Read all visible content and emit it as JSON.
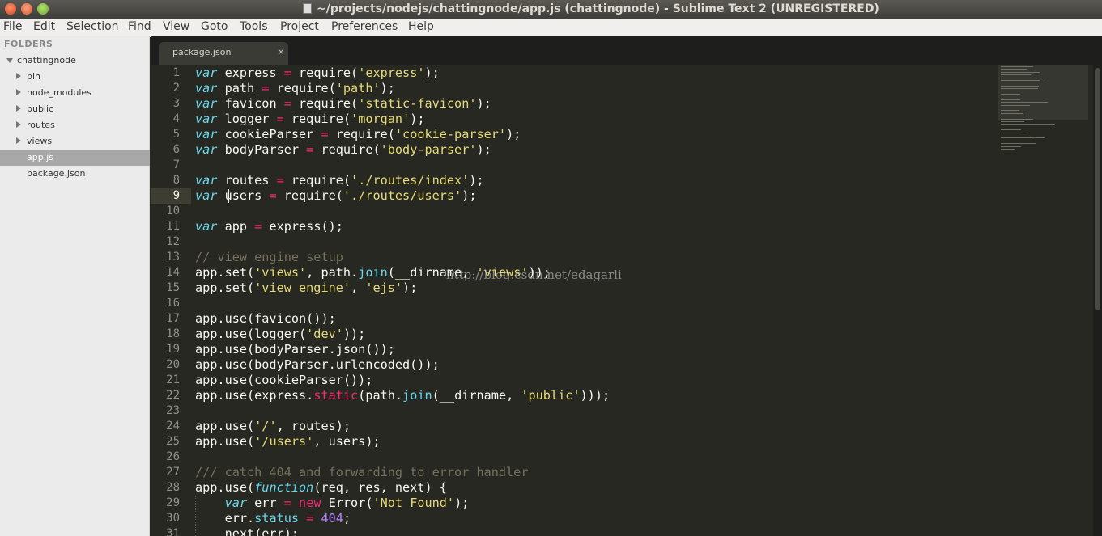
{
  "window": {
    "title": "~/projects/nodejs/chattingnode/app.js (chattingnode) - Sublime Text 2 (UNREGISTERED)",
    "close_icon": "close-icon",
    "minimize_icon": "minimize-icon",
    "maximize_icon": "maximize-icon"
  },
  "menu": [
    "File",
    "Edit",
    "Selection",
    "Find",
    "View",
    "Goto",
    "Tools",
    "Project",
    "Preferences",
    "Help"
  ],
  "sidebar": {
    "header": "FOLDERS",
    "root": "chattingnode",
    "items": [
      {
        "label": "bin",
        "type": "folder"
      },
      {
        "label": "node_modules",
        "type": "folder"
      },
      {
        "label": "public",
        "type": "folder"
      },
      {
        "label": "routes",
        "type": "folder"
      },
      {
        "label": "views",
        "type": "folder"
      },
      {
        "label": "app.js",
        "type": "file",
        "selected": true
      },
      {
        "label": "package.json",
        "type": "file"
      }
    ]
  },
  "tabs": [
    {
      "label": "package.json",
      "close": "×"
    }
  ],
  "editor": {
    "active_line": 9,
    "lines": [
      [
        [
          "kw",
          "var"
        ],
        [
          "t",
          " express "
        ],
        [
          "op",
          "="
        ],
        [
          "t",
          " require("
        ],
        [
          "str",
          "'express'"
        ],
        [
          "t",
          ");"
        ]
      ],
      [
        [
          "kw",
          "var"
        ],
        [
          "t",
          " path "
        ],
        [
          "op",
          "="
        ],
        [
          "t",
          " require("
        ],
        [
          "str",
          "'path'"
        ],
        [
          "t",
          ");"
        ]
      ],
      [
        [
          "kw",
          "var"
        ],
        [
          "t",
          " favicon "
        ],
        [
          "op",
          "="
        ],
        [
          "t",
          " require("
        ],
        [
          "str",
          "'static-favicon'"
        ],
        [
          "t",
          ");"
        ]
      ],
      [
        [
          "kw",
          "var"
        ],
        [
          "t",
          " logger "
        ],
        [
          "op",
          "="
        ],
        [
          "t",
          " require("
        ],
        [
          "str",
          "'morgan'"
        ],
        [
          "t",
          ");"
        ]
      ],
      [
        [
          "kw",
          "var"
        ],
        [
          "t",
          " cookieParser "
        ],
        [
          "op",
          "="
        ],
        [
          "t",
          " require("
        ],
        [
          "str",
          "'cookie-parser'"
        ],
        [
          "t",
          ");"
        ]
      ],
      [
        [
          "kw",
          "var"
        ],
        [
          "t",
          " bodyParser "
        ],
        [
          "op",
          "="
        ],
        [
          "t",
          " require("
        ],
        [
          "str",
          "'body-parser'"
        ],
        [
          "t",
          ");"
        ]
      ],
      [],
      [
        [
          "kw",
          "var"
        ],
        [
          "t",
          " routes "
        ],
        [
          "op",
          "="
        ],
        [
          "t",
          " require("
        ],
        [
          "str",
          "'./routes/index'"
        ],
        [
          "t",
          ");"
        ]
      ],
      [
        [
          "kw",
          "var"
        ],
        [
          "t",
          " users "
        ],
        [
          "op",
          "="
        ],
        [
          "t",
          " require("
        ],
        [
          "str",
          "'./routes/users'"
        ],
        [
          "t",
          ");"
        ]
      ],
      [],
      [
        [
          "kw",
          "var"
        ],
        [
          "t",
          " app "
        ],
        [
          "op",
          "="
        ],
        [
          "t",
          " express();"
        ]
      ],
      [],
      [
        [
          "com",
          "// view engine setup"
        ]
      ],
      [
        [
          "t",
          "app.set("
        ],
        [
          "str",
          "'views'"
        ],
        [
          "t",
          ", path."
        ],
        [
          "fn",
          "join"
        ],
        [
          "t",
          "(__dirname, "
        ],
        [
          "str",
          "'views'"
        ],
        [
          "t",
          "));"
        ]
      ],
      [
        [
          "t",
          "app.set("
        ],
        [
          "str",
          "'view engine'"
        ],
        [
          "t",
          ", "
        ],
        [
          "str",
          "'ejs'"
        ],
        [
          "t",
          ");"
        ]
      ],
      [],
      [
        [
          "t",
          "app.use(favicon());"
        ]
      ],
      [
        [
          "t",
          "app.use(logger("
        ],
        [
          "str",
          "'dev'"
        ],
        [
          "t",
          "));"
        ]
      ],
      [
        [
          "t",
          "app.use(bodyParser.json());"
        ]
      ],
      [
        [
          "t",
          "app.use(bodyParser.urlencoded());"
        ]
      ],
      [
        [
          "t",
          "app.use(cookieParser());"
        ]
      ],
      [
        [
          "t",
          "app.use(express."
        ],
        [
          "op",
          "static"
        ],
        [
          "t",
          "(path."
        ],
        [
          "fn",
          "join"
        ],
        [
          "t",
          "(__dirname, "
        ],
        [
          "str",
          "'public'"
        ],
        [
          "t",
          ")));"
        ]
      ],
      [],
      [
        [
          "t",
          "app.use("
        ],
        [
          "str",
          "'/'"
        ],
        [
          "t",
          ", routes);"
        ]
      ],
      [
        [
          "t",
          "app.use("
        ],
        [
          "str",
          "'/users'"
        ],
        [
          "t",
          ", users);"
        ]
      ],
      [],
      [
        [
          "com",
          "/// catch 404 and forwarding to error handler"
        ]
      ],
      [
        [
          "t",
          "app.use("
        ],
        [
          "kw",
          "function"
        ],
        [
          "t",
          "(req, res, next) {"
        ]
      ],
      [
        [
          "t",
          "    "
        ],
        [
          "kw",
          "var"
        ],
        [
          "t",
          " err "
        ],
        [
          "op",
          "="
        ],
        [
          "t",
          " "
        ],
        [
          "op",
          "new"
        ],
        [
          "t",
          " Error("
        ],
        [
          "str",
          "'Not Found'"
        ],
        [
          "t",
          ");"
        ]
      ],
      [
        [
          "t",
          "    err."
        ],
        [
          "fn",
          "status"
        ],
        [
          "t",
          " "
        ],
        [
          "op",
          "="
        ],
        [
          "t",
          " "
        ],
        [
          "num",
          "404"
        ],
        [
          "t",
          ";"
        ]
      ],
      [
        [
          "t",
          "    next(err);"
        ]
      ]
    ]
  },
  "watermark": "http://blog.csdn.net/edagarli"
}
